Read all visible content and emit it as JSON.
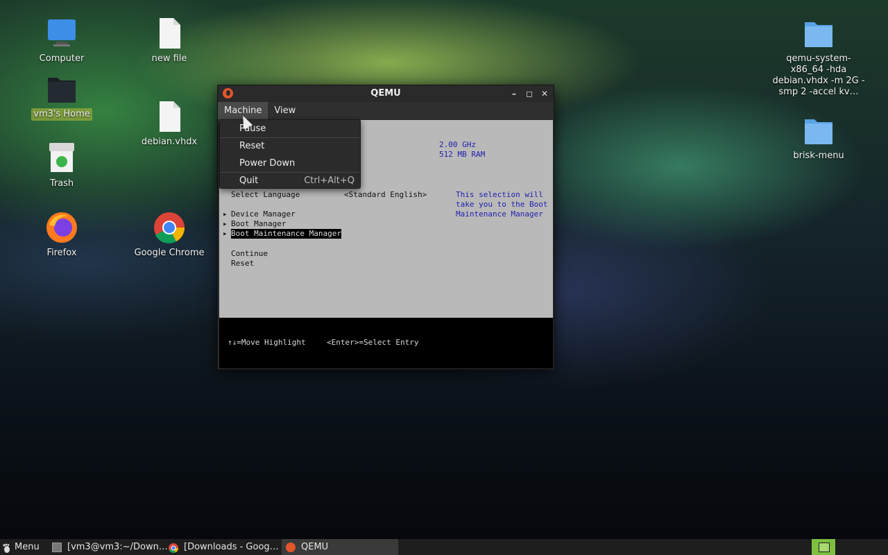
{
  "desktop": {
    "icons": [
      {
        "label": "Computer",
        "icon": "computer-icon"
      },
      {
        "label": "new file",
        "icon": "file-icon"
      },
      {
        "label": "vm3's Home",
        "icon": "home-folder-icon"
      },
      {
        "label": "debian.vhdx",
        "icon": "file-icon"
      },
      {
        "label": "Trash",
        "icon": "trash-icon"
      },
      {
        "label": "Firefox",
        "icon": "firefox-icon"
      },
      {
        "label": "Google Chrome",
        "icon": "chrome-icon"
      },
      {
        "label": "qemu-system-x86_64 -hda debian.vhdx -m 2G -smp 2 -accel kv…",
        "icon": "folder-icon"
      },
      {
        "label": "brisk-menu",
        "icon": "folder-icon"
      }
    ]
  },
  "qemu": {
    "title": "QEMU",
    "menubar": {
      "machine": "Machine",
      "view": "View"
    },
    "machine_menu": {
      "pause": "Pause",
      "reset": "Reset",
      "power_down": "Power Down",
      "quit": "Quit",
      "quit_shortcut": "Ctrl+Alt+Q"
    },
    "uefi": {
      "cpu_speed": "2.00 GHz",
      "ram": "512 MB RAM",
      "select_language_label": "Select Language",
      "select_language_value": "<Standard English>",
      "help_line1": "This selection will",
      "help_line2": "take you to the Boot",
      "help_line3": "Maintenance Manager",
      "device_manager": "Device Manager",
      "boot_manager": "Boot Manager",
      "boot_maintenance_manager": "Boot Maintenance Manager",
      "continue": "Continue",
      "reset": "Reset",
      "footer_move": "↑↓=Move Highlight",
      "footer_select": "<Enter>=Select Entry"
    }
  },
  "taskbar": {
    "menu": "Menu",
    "terminal": "[vm3@vm3:~/Down…",
    "chrome": "[Downloads - Goog…",
    "qemu": "QEMU"
  },
  "colors": {
    "accent": "#7fbf3f",
    "selection": "#96aa3c",
    "uefi_bg": "#b9b9b9",
    "uefi_blue": "#1f1fb0"
  }
}
